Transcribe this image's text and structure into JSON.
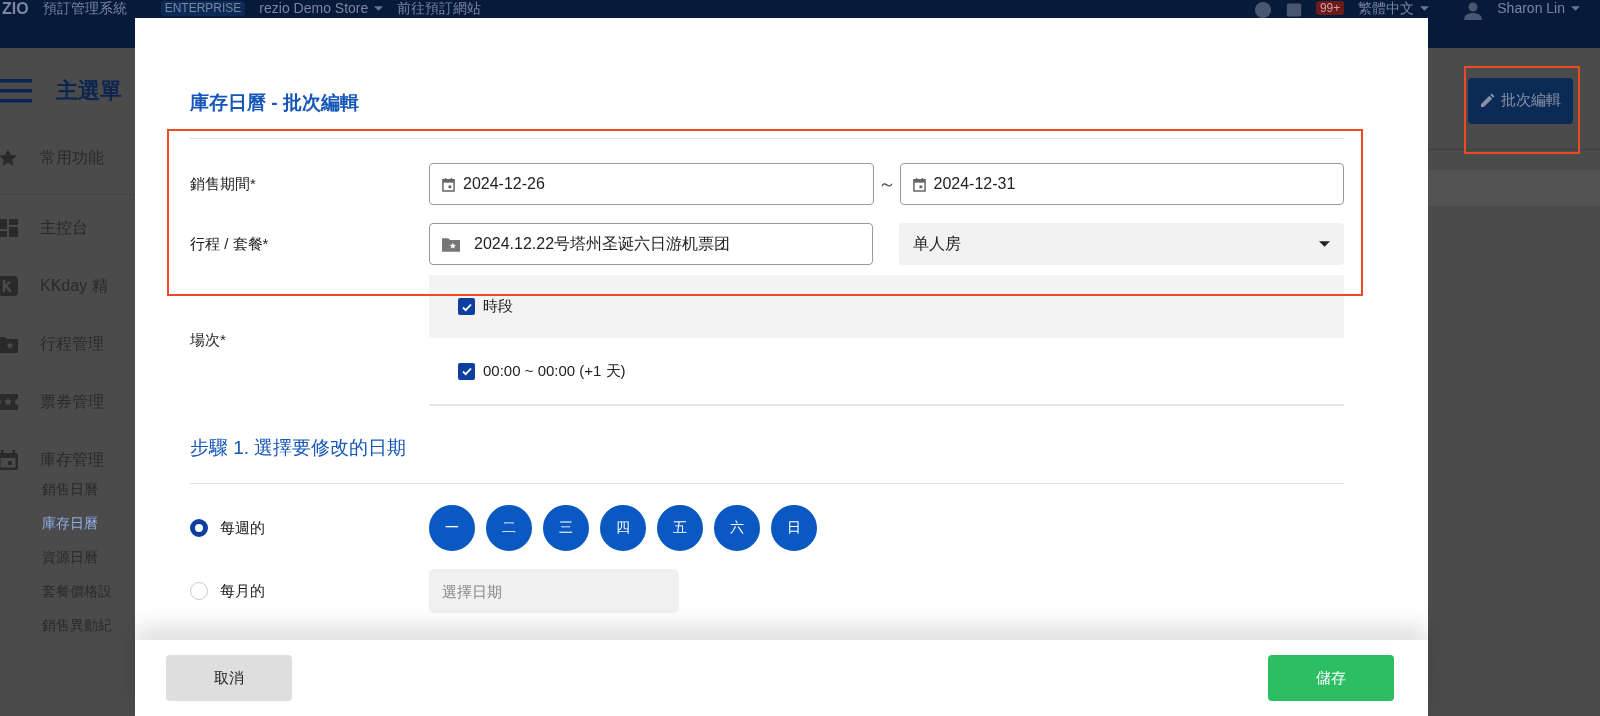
{
  "app_bar": {
    "logo": "ZIO",
    "system_name": "預訂管理系統",
    "plan_badge": "ENTERPRISE",
    "store": "rezio Demo Store",
    "site_link": "前往預訂網站",
    "notification_count": "99+",
    "language": "繁體中文",
    "user": "Sharon Lin"
  },
  "sidebar": {
    "title": "主選單",
    "items": [
      {
        "label": "常用功能"
      },
      {
        "label": "主控台"
      },
      {
        "label": "KKday 精"
      },
      {
        "label": "行程管理"
      },
      {
        "label": "票券管理"
      },
      {
        "label": "庫存管理"
      }
    ],
    "sub_items": [
      {
        "label": "銷售日曆",
        "selected": false
      },
      {
        "label": "庫存日曆",
        "selected": true
      },
      {
        "label": "資源日曆",
        "selected": false
      },
      {
        "label": "套餐價格設",
        "selected": false
      },
      {
        "label": "銷售異動紀",
        "selected": false
      }
    ]
  },
  "page_action": {
    "label": "批次編輯"
  },
  "dialog": {
    "title": "庫存日曆 - 批次編輯",
    "sale_period": {
      "label": "銷售期間*",
      "start": "2024-12-26",
      "separator": "～",
      "end": "2024-12-31"
    },
    "product": {
      "label": "行程 / 套餐*",
      "tour": "2024.12.22号塔州圣诞六日游机票团",
      "package": "单人房"
    },
    "sessions": {
      "label": "場次*",
      "options": [
        {
          "label": "時段",
          "checked": true
        },
        {
          "label": "00:00 ~ 00:00 (+1 天)",
          "checked": true
        }
      ]
    },
    "step1": {
      "title": "步驟 1. 選擇要修改的日期",
      "modes": [
        {
          "label": "每週的",
          "selected": true
        },
        {
          "label": "每月的",
          "selected": false
        }
      ],
      "weekdays": [
        {
          "label": "一",
          "selected": true
        },
        {
          "label": "二",
          "selected": true
        },
        {
          "label": "三",
          "selected": true
        },
        {
          "label": "四",
          "selected": true
        },
        {
          "label": "五",
          "selected": true
        },
        {
          "label": "六",
          "selected": true
        },
        {
          "label": "日",
          "selected": true
        }
      ],
      "date_placeholder": "選擇日期"
    },
    "buttons": {
      "cancel": "取消",
      "save": "儲存"
    }
  }
}
